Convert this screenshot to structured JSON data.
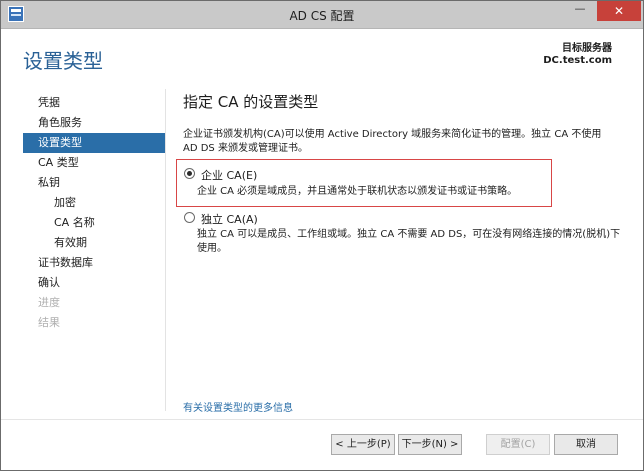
{
  "window": {
    "title": "AD CS 配置",
    "minimize": "—",
    "close": "✕"
  },
  "header": {
    "page_title": "设置类型",
    "target_label": "目标服务器",
    "target_name": "DC.test.com"
  },
  "nav": {
    "items": [
      {
        "label": "凭据",
        "state": "normal"
      },
      {
        "label": "角色服务",
        "state": "normal"
      },
      {
        "label": "设置类型",
        "state": "active"
      },
      {
        "label": "CA 类型",
        "state": "normal"
      },
      {
        "label": "私钥",
        "state": "normal"
      },
      {
        "label": "加密",
        "state": "sub"
      },
      {
        "label": "CA 名称",
        "state": "sub"
      },
      {
        "label": "有效期",
        "state": "sub"
      },
      {
        "label": "证书数据库",
        "state": "normal"
      },
      {
        "label": "确认",
        "state": "normal"
      },
      {
        "label": "进度",
        "state": "disabled"
      },
      {
        "label": "结果",
        "state": "disabled"
      }
    ]
  },
  "content": {
    "section_title": "指定 CA 的设置类型",
    "description": "企业证书颁发机构(CA)可以使用 Active Directory 域服务来简化证书的管理。独立 CA 不使用 AD DS 来颁发或管理证书。",
    "options": [
      {
        "label": "企业 CA(E)",
        "selected": true,
        "description": "企业 CA 必须是域成员，并且通常处于联机状态以颁发证书或证书策略。"
      },
      {
        "label": "独立 CA(A)",
        "selected": false,
        "description": "独立 CA 可以是成员、工作组或域。独立 CA 不需要 AD DS，可在没有网络连接的情况(脱机)下使用。"
      }
    ],
    "more_link": "有关设置类型的更多信息"
  },
  "footer": {
    "prev": "< 上一步(P)",
    "next": "下一步(N) >",
    "configure": "配置(C)",
    "cancel": "取消"
  },
  "colors": {
    "accent": "#2a6ea8",
    "title": "#2a6196",
    "highlight": "#d84646",
    "close": "#c7413a"
  }
}
